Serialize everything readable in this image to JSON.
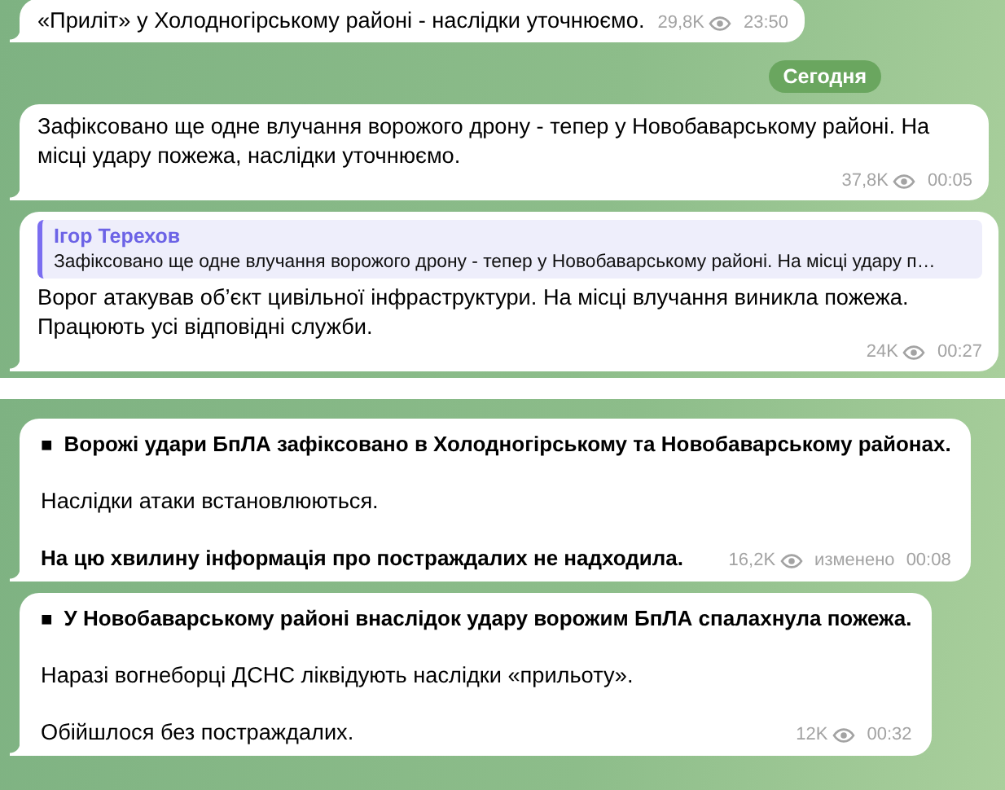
{
  "panels": [
    {
      "items": [
        {
          "kind": "message",
          "paragraphs": [
            {
              "text": "«Приліт» у Холодногірському районі - наслідки уточнюємо.",
              "bold": false
            }
          ],
          "views": "29,8K",
          "time": "23:50"
        },
        {
          "kind": "date",
          "label": "Сегодня"
        },
        {
          "kind": "message",
          "paragraphs": [
            {
              "text": "Зафіксовано ще одне влучання ворожого дрону - тепер у Новобаварському районі. На місці удару пожежа, наслідки уточнюємо.",
              "bold": false
            }
          ],
          "views": "37,8K",
          "time": "00:05"
        },
        {
          "kind": "message",
          "reply": {
            "author": "Ігор Терехов",
            "text": "Зафіксовано ще одне влучання ворожого дрону - тепер у Новобаварському районі. На місці удару п…"
          },
          "paragraphs": [
            {
              "text": "Ворог атакував об’єкт цивільної інфраструктури. На місці влучання виникла пожежа. Працюють усі відповідні служби.",
              "bold": false
            }
          ],
          "views": "24K",
          "time": "00:27"
        }
      ]
    },
    {
      "items": [
        {
          "kind": "message",
          "bullet": "■",
          "paragraphs": [
            {
              "text": "Ворожі удари БпЛА зафіксовано в Холодногірському та Новобаварському районах.",
              "bold": true
            },
            {
              "text": "Наслідки атаки встановлюються.",
              "bold": false
            },
            {
              "text": "На цю хвилину інформація про постраждалих не надходила.",
              "bold": true
            }
          ],
          "views": "16,2K",
          "edited": "изменено",
          "time": "00:08"
        },
        {
          "kind": "message",
          "bullet": "■",
          "paragraphs": [
            {
              "text": "У Новобаварському районі внаслідок удару ворожим БпЛА спалахнула пожежа.",
              "bold": true
            },
            {
              "text": "Наразі вогнеборці ДСНС ліквідують наслідки «прильоту».",
              "bold": false
            },
            {
              "text": "Обійшлося без постраждалих.",
              "bold": false
            }
          ],
          "views": "12K",
          "time": "00:32"
        }
      ]
    }
  ]
}
